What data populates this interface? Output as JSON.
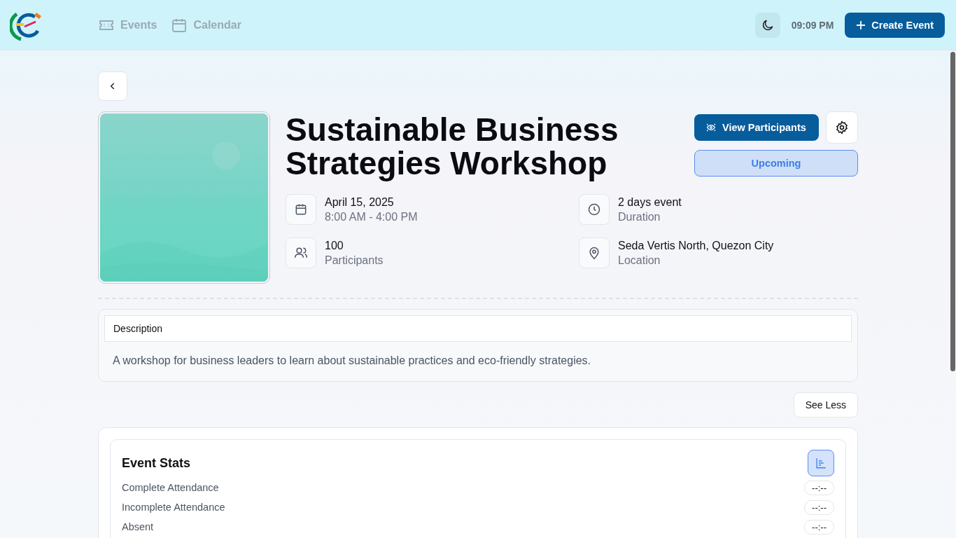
{
  "header": {
    "nav": [
      {
        "label": "Events"
      },
      {
        "label": "Calendar"
      }
    ],
    "time": "09:09 PM",
    "create_button": "Create Event"
  },
  "event": {
    "title": "Sustainable Business Strategies Workshop",
    "view_participants": "View Participants",
    "status": "Upcoming",
    "details": [
      {
        "value": "April 15, 2025",
        "label": "8:00 AM - 4:00 PM"
      },
      {
        "value": "2 days event",
        "label": "Duration"
      },
      {
        "value": "100",
        "label": "Participants"
      },
      {
        "value": "Seda Vertis North, Quezon City",
        "label": "Location"
      }
    ],
    "description_heading": "Description",
    "description": "A workshop for business leaders to learn about sustainable practices and eco-friendly strategies.",
    "see_less": "See Less"
  },
  "stats": {
    "title": "Event Stats",
    "rows": [
      {
        "label": "Complete Attendance",
        "value": "--:--"
      },
      {
        "label": "Incomplete Attendance",
        "value": "--:--"
      },
      {
        "label": "Absent",
        "value": "--:--"
      }
    ]
  }
}
